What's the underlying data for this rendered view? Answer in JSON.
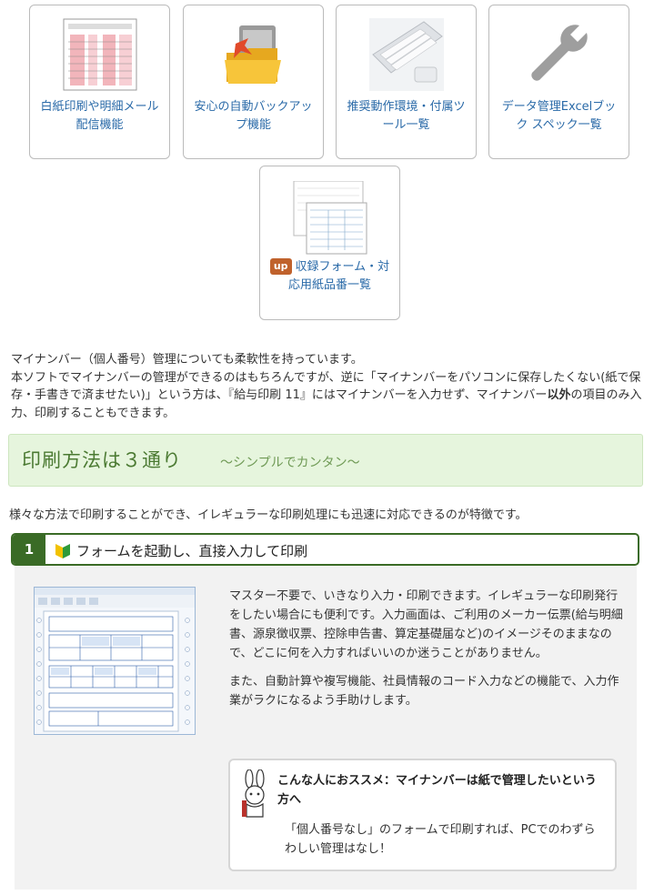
{
  "cards": [
    {
      "label": "白紙印刷や明細メール配信機能"
    },
    {
      "label": "安心の自動バックアップ機能"
    },
    {
      "label": "推奨動作環境・付属ツール一覧"
    },
    {
      "label": "データ管理Excelブック スペック一覧"
    },
    {
      "badge": "up",
      "label": "収録フォーム・対応用紙品番一覧"
    }
  ],
  "intro": {
    "line1": "マイナンバー（個人番号）管理についても柔軟性を持っています。",
    "line2": "本ソフトでマイナンバーの管理ができるのはもちろんですが、逆に「マイナンバーをパソコンに保存したくない(紙で保存・手書きで済ませたい)」という方は、『給与印刷 11』にはマイナンバーを入力せず、マイナンバー",
    "bold": "以外",
    "line3": "の項目のみ入力、印刷することもできます。"
  },
  "section": {
    "title": "印刷方法は３通り",
    "subtitle": "～シンプルでカンタン～"
  },
  "lead": "様々な方法で印刷することができ、イレギュラーな印刷処理にも迅速に対応できるのが特徴です。",
  "step": {
    "number": "1",
    "title": "フォームを起動し、直接入力して印刷"
  },
  "description": {
    "p1": "マスター不要で、いきなり入力・印刷できます。イレギュラーな印刷発行をしたい場合にも便利です。入力画面は、ご利用のメーカー伝票(給与明細書、源泉徴収票、控除申告書、算定基礎届など)のイメージそのままなので、どこに何を入力すればいいのか迷うことがありません。",
    "p2": "また、自動計算や複写機能、社員情報のコード入力などの機能で、入力作業がラクになるよう手助けします。"
  },
  "tip": {
    "title": "こんな人におススメ：マイナンバーは紙で管理したいという方へ",
    "body": "「個人番号なし」のフォームで印刷すれば、PCでのわずらわしい管理はなし！"
  },
  "colors": {
    "link": "#2a6aa8",
    "accent_green": "#3a6b26",
    "head_bg": "#e6f5dd",
    "badge": "#c0622c"
  }
}
